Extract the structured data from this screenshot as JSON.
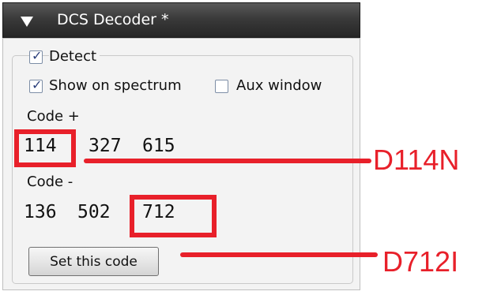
{
  "header": {
    "title": "DCS Decoder *",
    "collapse_icon": "triangle-down-icon"
  },
  "options": {
    "detect_label": "Detect",
    "detect_checked": true,
    "show_spectrum_label": "Show on spectrum",
    "show_spectrum_checked": true,
    "aux_window_label": "Aux window",
    "aux_window_checked": false
  },
  "code_plus": {
    "label": "Code +",
    "values": [
      "114",
      "327",
      "615"
    ]
  },
  "code_minus": {
    "label": "Code -",
    "values": [
      "136",
      "502",
      "712"
    ]
  },
  "set_code_button": "Set this code",
  "annotations": {
    "plus_code": "D114N",
    "minus_code": "D712I",
    "color": "#e8202a"
  }
}
